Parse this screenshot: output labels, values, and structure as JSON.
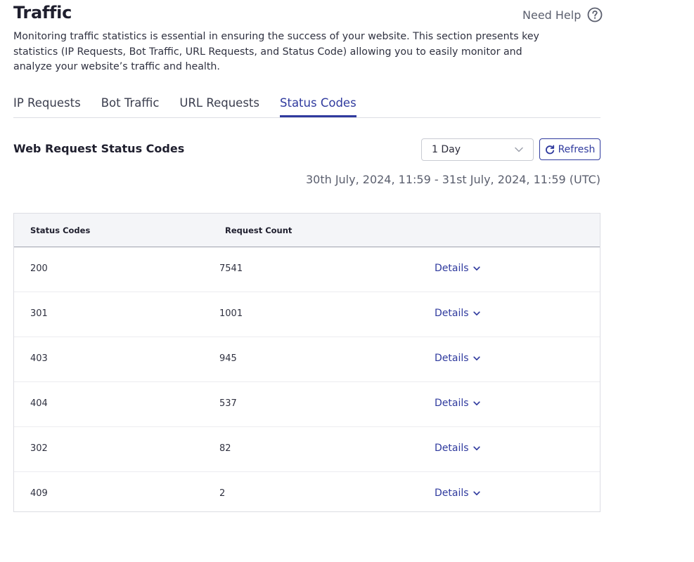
{
  "header": {
    "title": "Traffic",
    "help_label": "Need Help",
    "help_icon": "question-circle-icon",
    "description": "Monitoring traffic statistics is essential in ensuring the success of your website. This section presents key statistics (IP Requests, Bot Traffic, URL Requests, and Status Code) allowing you to easily monitor and analyze your website’s traffic and health."
  },
  "tabs": [
    {
      "label": "IP Requests",
      "active": false
    },
    {
      "label": "Bot Traffic",
      "active": false
    },
    {
      "label": "URL Requests",
      "active": false
    },
    {
      "label": "Status Codes",
      "active": true
    }
  ],
  "section": {
    "title": "Web Request Status Codes",
    "range_select": {
      "value": "1 Day"
    },
    "refresh_label": "Refresh",
    "date_range": "30th July, 2024, 11:59 - 31st July, 2024, 11:59 (UTC)"
  },
  "table": {
    "columns": [
      "Status Codes",
      "Request Count"
    ],
    "details_label": "Details",
    "rows": [
      {
        "code": "200",
        "count": "7541"
      },
      {
        "code": "301",
        "count": "1001"
      },
      {
        "code": "403",
        "count": "945"
      },
      {
        "code": "404",
        "count": "537"
      },
      {
        "code": "302",
        "count": "82"
      },
      {
        "code": "409",
        "count": "2"
      }
    ]
  },
  "colors": {
    "accent": "#2f3a9e",
    "text": "#2b2b3a",
    "muted": "#5b5f6e",
    "table_header_bg": "#f4f5f8",
    "border": "#dcdde3"
  }
}
